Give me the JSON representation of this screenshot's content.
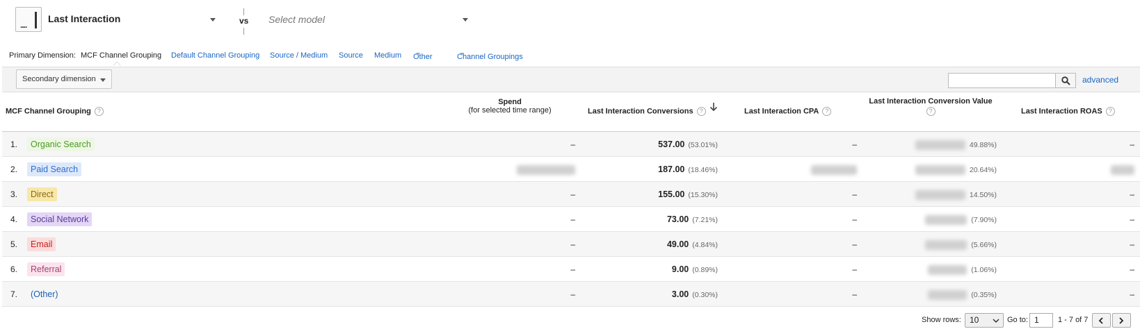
{
  "model_bar": {
    "model_name": "Last Interaction",
    "icon_dots": "....",
    "vs_label": "vs",
    "select_model_placeholder": "Select model"
  },
  "primary_dimension": {
    "label": "Primary Dimension:",
    "active": "MCF Channel Grouping",
    "links": [
      "Default Channel Grouping",
      "Source / Medium",
      "Source",
      "Medium",
      "Other",
      "Channel Groupings"
    ]
  },
  "toolbar": {
    "secondary_dimension_label": "Secondary dimension",
    "search_value": "",
    "advanced_label": "advanced"
  },
  "table": {
    "headers": {
      "channel": "MCF Channel Grouping",
      "spend": "Spend",
      "spend_sub": "(for selected time range)",
      "conversions": "Last Interaction Conversions",
      "cpa": "Last Interaction CPA",
      "conv_value": "Last Interaction Conversion Value",
      "roas": "Last Interaction ROAS"
    },
    "help_glyph": "?",
    "rows": [
      {
        "index": "1.",
        "channel": "Organic Search",
        "chip_bg": "#eef7e6",
        "chip_fg": "#4a9a1e",
        "spend": "–",
        "conv": "537.00",
        "conv_pct": "(53.01%)",
        "cpa": "–",
        "cval_pct": "49.88%)",
        "roas": "–"
      },
      {
        "index": "2.",
        "channel": "Paid Search",
        "chip_bg": "#dde9fb",
        "chip_fg": "#2e6cc9",
        "spend": "",
        "conv": "187.00",
        "conv_pct": "(18.46%)",
        "cpa": "",
        "cval_pct": "20.64%)",
        "roas": ""
      },
      {
        "index": "3.",
        "channel": "Direct",
        "chip_bg": "#f8e7a8",
        "chip_fg": "#8a6a10",
        "spend": "–",
        "conv": "155.00",
        "conv_pct": "(15.30%)",
        "cpa": "–",
        "cval_pct": "14.50%)",
        "roas": "–"
      },
      {
        "index": "4.",
        "channel": "Social Network",
        "chip_bg": "#e3d6f6",
        "chip_fg": "#5b3a9a",
        "spend": "–",
        "conv": "73.00",
        "conv_pct": "(7.21%)",
        "cpa": "–",
        "cval_pct": "(7.90%)",
        "roas": "–"
      },
      {
        "index": "5.",
        "channel": "Email",
        "chip_bg": "#fbdcdc",
        "chip_fg": "#c81e1e",
        "spend": "–",
        "conv": "49.00",
        "conv_pct": "(4.84%)",
        "cpa": "–",
        "cval_pct": "(5.66%)",
        "roas": "–"
      },
      {
        "index": "6.",
        "channel": "Referral",
        "chip_bg": "#fbe4ee",
        "chip_fg": "#a2456e",
        "spend": "–",
        "conv": "9.00",
        "conv_pct": "(0.89%)",
        "cpa": "–",
        "cval_pct": "(1.06%)",
        "roas": "–"
      },
      {
        "index": "7.",
        "channel": "(Other)",
        "chip_bg": "transparent",
        "chip_fg": "#1a5fb4",
        "spend": "–",
        "conv": "3.00",
        "conv_pct": "(0.30%)",
        "cpa": "–",
        "cval_pct": "(0.35%)",
        "roas": "–"
      }
    ]
  },
  "footer": {
    "show_rows_label": "Show rows:",
    "show_rows_value": "10",
    "goto_label": "Go to:",
    "goto_value": "1",
    "range_label": "1 - 7 of 7"
  },
  "icons": {
    "sort": "sort-down-arrow-icon",
    "search": "magnifier-icon",
    "prev": "chevron-left-icon",
    "next": "chevron-right-icon"
  },
  "colors": {
    "link": "#1a66c2",
    "sorted_column_bg": "#ececec"
  }
}
